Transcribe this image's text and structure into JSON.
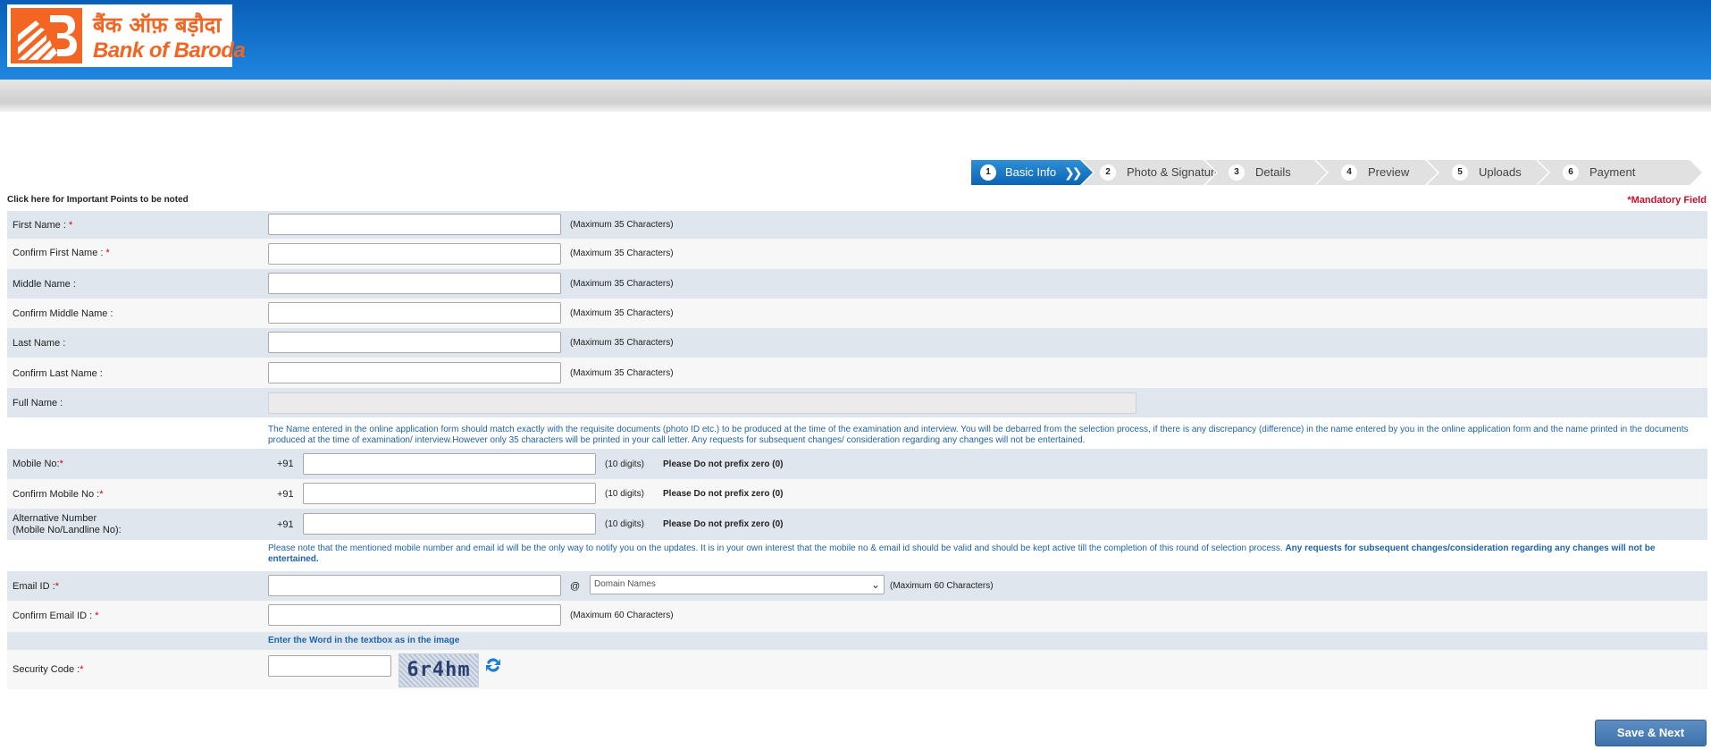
{
  "brand": {
    "name_hindi": "बैंक ऑफ़ बड़ौदा",
    "name_english": "Bank of Baroda",
    "brand_color": "#f26522",
    "header_color": "#0a5fb8"
  },
  "steps": [
    {
      "num": "1",
      "label": "Basic Info",
      "active": true
    },
    {
      "num": "2",
      "label": "Photo & Signature"
    },
    {
      "num": "3",
      "label": "Details"
    },
    {
      "num": "4",
      "label": "Preview"
    },
    {
      "num": "5",
      "label": "Uploads"
    },
    {
      "num": "6",
      "label": "Payment"
    }
  ],
  "important_link": "Click here for Important Points to be noted",
  "mandatory_label": "*Mandatory Field",
  "form": {
    "first_name": {
      "label": "First Name : ",
      "required": "*",
      "hint": "(Maximum 35 Characters)",
      "value": ""
    },
    "confirm_first_name": {
      "label": "Confirm First Name : ",
      "required": "*",
      "hint": "(Maximum 35 Characters)",
      "value": ""
    },
    "middle_name": {
      "label": "Middle Name :",
      "hint": "(Maximum 35 Characters)",
      "value": ""
    },
    "confirm_middle_name": {
      "label": "Confirm Middle Name :",
      "hint": "(Maximum 35 Characters)",
      "value": ""
    },
    "last_name": {
      "label": "Last Name :",
      "hint": "(Maximum 35 Characters)",
      "value": ""
    },
    "confirm_last_name": {
      "label": "Confirm Last Name :",
      "hint": "(Maximum 35 Characters)",
      "value": ""
    },
    "full_name": {
      "label": "Full Name :",
      "value": ""
    },
    "name_note": "The Name entered in the online application form should match exactly with the requisite documents (photo ID etc.) to be produced at the time of the examination and interview. You will be debarred from the selection process, if there is any discrepancy (difference) in the name entered by you in the online application form and the name printed in the documents produced at the time of examination/ interview.However only 35 characters will be printed in your call letter. Any requests for subsequent changes/ consideration regarding any changes will not be entertained.",
    "mobile": {
      "label": "Mobile No:",
      "required": "*",
      "country_code": "+91",
      "hint": "(10 digits)",
      "note": "Please Do not prefix zero (0)",
      "value": ""
    },
    "confirm_mobile": {
      "label": "Confirm Mobile No :",
      "required": "*",
      "country_code": "+91",
      "hint": "(10 digits)",
      "note": "Please Do not prefix zero (0)",
      "value": ""
    },
    "alt_number": {
      "label_line1": "Alternative Number",
      "label_line2": "(Mobile No/Landline No):",
      "country_code": "+91",
      "hint": "(10 digits)",
      "note": "Please Do not prefix zero (0)",
      "value": ""
    },
    "contact_note_normal": "Please note that the mentioned mobile number and email id will be the only way to notify you on the updates. It is in your own interest that the mobile no & email id should be valid and should be kept active till the completion of this round of selection process. ",
    "contact_note_bold": "Any requests for subsequent changes/consideration regarding any changes will not be entertained.",
    "email": {
      "label": "Email ID :",
      "required": "*",
      "at": "@",
      "domain_selected": "Domain Names",
      "hint": "(Maximum 60 Characters)",
      "value": ""
    },
    "confirm_email": {
      "label": "Confirm Email ID : ",
      "required": "*",
      "hint": "(Maximum 60 Characters)",
      "value": ""
    },
    "captcha_instruction": "Enter the Word in the textbox as in the image",
    "security_code": {
      "label": "Security Code :",
      "required": "*",
      "captcha_text": "6r4hm",
      "value": ""
    }
  },
  "actions": {
    "save_next": "Save & Next"
  }
}
